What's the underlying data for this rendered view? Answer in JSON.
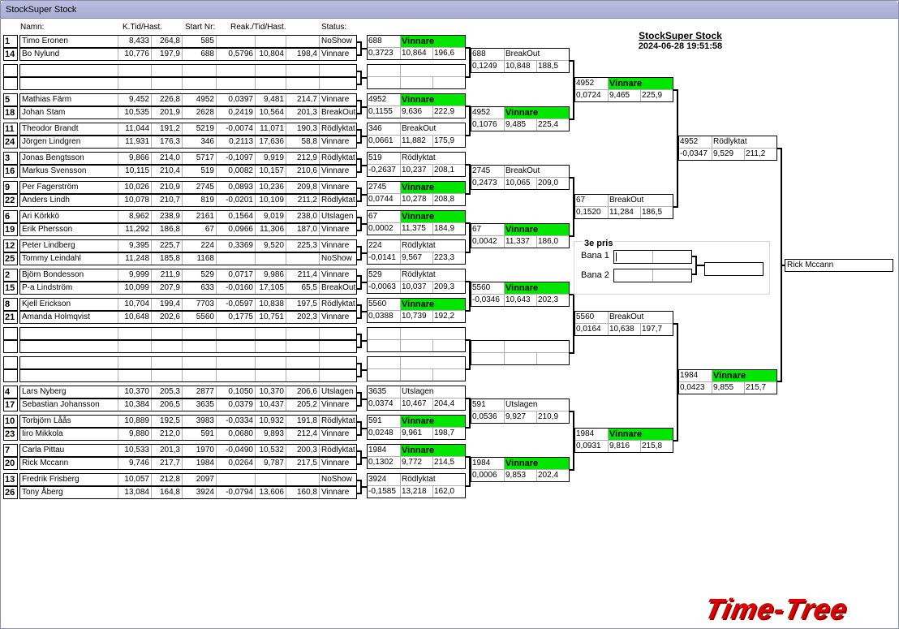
{
  "window": {
    "title": "StockSuper Stock"
  },
  "header": {
    "title": "StockSuper Stock",
    "datetime": "2024-06-28 19:51:58"
  },
  "columns": {
    "name": "Namn:",
    "ktid": "K.Tid/Hast.",
    "start": "Start Nr:",
    "reak": "Reak./Tid/Hast.",
    "status": "Status:"
  },
  "round1": [
    {
      "seed": "1",
      "name": "Timo Eronen",
      "kt": "8,433",
      "kh": "264,8",
      "start": "585",
      "r": "",
      "t": "",
      "h": "",
      "status": "NoShow"
    },
    {
      "seed": "14",
      "name": "Bo Nylund",
      "kt": "10,776",
      "kh": "197,9",
      "start": "688",
      "r": "0,5796",
      "t": "10,804",
      "h": "198,4",
      "status": "Vinnare"
    },
    {
      "seed": "",
      "name": "",
      "kt": "",
      "kh": "",
      "start": "",
      "r": "",
      "t": "",
      "h": "",
      "status": ""
    },
    {
      "seed": "",
      "name": "",
      "kt": "",
      "kh": "",
      "start": "",
      "r": "",
      "t": "",
      "h": "",
      "status": ""
    },
    {
      "seed": "5",
      "name": "Mathias Färm",
      "kt": "9,452",
      "kh": "226,8",
      "start": "4952",
      "r": "0,0397",
      "t": "9,481",
      "h": "214,7",
      "status": "Vinnare"
    },
    {
      "seed": "18",
      "name": "Johan Stam",
      "kt": "10,535",
      "kh": "201,9",
      "start": "2628",
      "r": "0,2419",
      "t": "10,564",
      "h": "201,3",
      "status": "BreakOut"
    },
    {
      "seed": "11",
      "name": "Theodor Brandt",
      "kt": "11,044",
      "kh": "191,2",
      "start": "5219",
      "r": "-0,0074",
      "t": "11,071",
      "h": "190,3",
      "status": "Rödlyktat"
    },
    {
      "seed": "24",
      "name": "Jörgen Lindgren",
      "kt": "11,931",
      "kh": "176,3",
      "start": "346",
      "r": "0,2113",
      "t": "17,636",
      "h": "58,8",
      "status": "Vinnare"
    },
    {
      "seed": "3",
      "name": "Jonas Bengtsson",
      "kt": "9,866",
      "kh": "214,0",
      "start": "5717",
      "r": "-0,1097",
      "t": "9,919",
      "h": "212,9",
      "status": "Rödlyktat"
    },
    {
      "seed": "16",
      "name": "Markus Svensson",
      "kt": "10,115",
      "kh": "210,4",
      "start": "519",
      "r": "0,0082",
      "t": "10,157",
      "h": "210,6",
      "status": "Vinnare"
    },
    {
      "seed": "9",
      "name": "Per  Fagerström",
      "kt": "10,026",
      "kh": "210,9",
      "start": "2745",
      "r": "0,0893",
      "t": "10,236",
      "h": "209,8",
      "status": "Vinnare"
    },
    {
      "seed": "22",
      "name": "Anders Lindh",
      "kt": "10,078",
      "kh": "210,7",
      "start": "819",
      "r": "-0,0201",
      "t": "10,109",
      "h": "211,2",
      "status": "Rödlyktat"
    },
    {
      "seed": "6",
      "name": "Ari Körkkö",
      "kt": "8,962",
      "kh": "238,9",
      "start": "2161",
      "r": "0,1564",
      "t": "9,019",
      "h": "238,0",
      "status": "Utslagen"
    },
    {
      "seed": "19",
      "name": "Erik Phersson",
      "kt": "11,292",
      "kh": "186,8",
      "start": "67",
      "r": "0,0966",
      "t": "11,306",
      "h": "187,0",
      "status": "Vinnare"
    },
    {
      "seed": "12",
      "name": "Peter Lindberg",
      "kt": "9,395",
      "kh": "225,7",
      "start": "224",
      "r": "0,3369",
      "t": "9,520",
      "h": "225,3",
      "status": "Vinnare"
    },
    {
      "seed": "25",
      "name": "Tommy  Leindahl",
      "kt": "11,248",
      "kh": "185,8",
      "start": "1168",
      "r": "",
      "t": "",
      "h": "",
      "status": "NoShow"
    },
    {
      "seed": "2",
      "name": "Björn Bondesson",
      "kt": "9,999",
      "kh": "211,9",
      "start": "529",
      "r": "0,0717",
      "t": "9,986",
      "h": "211,4",
      "status": "Vinnare"
    },
    {
      "seed": "15",
      "name": "P-a Lindström",
      "kt": "10,099",
      "kh": "207,9",
      "start": "633",
      "r": "-0,0160",
      "t": "17,105",
      "h": "65,5",
      "status": "BreakOut"
    },
    {
      "seed": "8",
      "name": "Kjell Erickson",
      "kt": "10,704",
      "kh": "199,4",
      "start": "7703",
      "r": "-0,0597",
      "t": "10,838",
      "h": "197,5",
      "status": "Rödlyktat"
    },
    {
      "seed": "21",
      "name": "Amanda Holmqvist",
      "kt": "10,648",
      "kh": "202,6",
      "start": "5560",
      "r": "0,1775",
      "t": "10,751",
      "h": "202,3",
      "status": "Vinnare"
    },
    {
      "seed": "",
      "name": "",
      "kt": "",
      "kh": "",
      "start": "",
      "r": "",
      "t": "",
      "h": "",
      "status": ""
    },
    {
      "seed": "",
      "name": "",
      "kt": "",
      "kh": "",
      "start": "",
      "r": "",
      "t": "",
      "h": "",
      "status": ""
    },
    {
      "seed": "",
      "name": "",
      "kt": "",
      "kh": "",
      "start": "",
      "r": "",
      "t": "",
      "h": "",
      "status": ""
    },
    {
      "seed": "",
      "name": "",
      "kt": "",
      "kh": "",
      "start": "",
      "r": "",
      "t": "",
      "h": "",
      "status": ""
    },
    {
      "seed": "4",
      "name": "Lars Nyberg",
      "kt": "10,370",
      "kh": "205,3",
      "start": "2877",
      "r": "0,1050",
      "t": "10,370",
      "h": "206,6",
      "status": "Utslagen"
    },
    {
      "seed": "17",
      "name": "Sebastian Johansson",
      "kt": "10,384",
      "kh": "206,5",
      "start": "3635",
      "r": "0,0379",
      "t": "10,437",
      "h": "205,2",
      "status": "Vinnare"
    },
    {
      "seed": "10",
      "name": "Torbjörn Låås",
      "kt": "10,889",
      "kh": "192,5",
      "start": "3983",
      "r": "-0,0334",
      "t": "10,932",
      "h": "191,8",
      "status": "Rödlyktat"
    },
    {
      "seed": "23",
      "name": "Iiro Mikkola",
      "kt": "9,880",
      "kh": "212,0",
      "start": "591",
      "r": "0,0680",
      "t": "9,893",
      "h": "212,4",
      "status": "Vinnare"
    },
    {
      "seed": "7",
      "name": "Carla Pittau",
      "kt": "10,533",
      "kh": "201,3",
      "start": "1970",
      "r": "-0,0490",
      "t": "10,532",
      "h": "200,3",
      "status": "Rödlyktat"
    },
    {
      "seed": "20",
      "name": "Rick Mccann",
      "kt": "9,746",
      "kh": "217,7",
      "start": "1984",
      "r": "0,0264",
      "t": "9,787",
      "h": "217,5",
      "status": "Vinnare"
    },
    {
      "seed": "13",
      "name": "Fredrik Frisberg",
      "kt": "10,057",
      "kh": "212,8",
      "start": "2097",
      "r": "",
      "t": "",
      "h": "",
      "status": "NoShow"
    },
    {
      "seed": "26",
      "name": "Tony Åberg",
      "kt": "13,084",
      "kh": "164,8",
      "start": "3924",
      "r": "-0,0794",
      "t": "13,606",
      "h": "160,8",
      "status": "Vinnare"
    }
  ],
  "round2": [
    {
      "id": "688",
      "status": "Vinnare",
      "win": true,
      "r": "0,3723",
      "t": "10,864",
      "h": "196,6"
    },
    {
      "id": "",
      "status": "",
      "win": false,
      "r": "",
      "t": "",
      "h": ""
    },
    {
      "id": "4952",
      "status": "Vinnare",
      "win": true,
      "r": "0,1155",
      "t": "9,636",
      "h": "222,9"
    },
    {
      "id": "346",
      "status": "BreakOut",
      "win": false,
      "r": "0,0661",
      "t": "11,882",
      "h": "175,9"
    },
    {
      "id": "519",
      "status": "Rödlyktat",
      "win": false,
      "r": "-0,2637",
      "t": "10,237",
      "h": "208,1"
    },
    {
      "id": "2745",
      "status": "Vinnare",
      "win": true,
      "r": "0,0744",
      "t": "10,278",
      "h": "208,8"
    },
    {
      "id": "67",
      "status": "Vinnare",
      "win": true,
      "r": "0,0002",
      "t": "11,375",
      "h": "184,9"
    },
    {
      "id": "224",
      "status": "Rödlyktat",
      "win": false,
      "r": "-0,0141",
      "t": "9,567",
      "h": "223,3"
    },
    {
      "id": "529",
      "status": "Rödlyktat",
      "win": false,
      "r": "-0,0063",
      "t": "10,037",
      "h": "209,3"
    },
    {
      "id": "5560",
      "status": "Vinnare",
      "win": true,
      "r": "0,0388",
      "t": "10,739",
      "h": "192,2"
    },
    {
      "id": "",
      "status": "",
      "win": false,
      "r": "",
      "t": "",
      "h": ""
    },
    {
      "id": "",
      "status": "",
      "win": false,
      "r": "",
      "t": "",
      "h": ""
    },
    {
      "id": "3635",
      "status": "Utslagen",
      "win": false,
      "r": "0,0374",
      "t": "10,467",
      "h": "204,4"
    },
    {
      "id": "591",
      "status": "Vinnare",
      "win": true,
      "r": "0,0248",
      "t": "9,961",
      "h": "198,7"
    },
    {
      "id": "1984",
      "status": "Vinnare",
      "win": true,
      "r": "0,1302",
      "t": "9,772",
      "h": "214,5"
    },
    {
      "id": "3924",
      "status": "Rödlyktat",
      "win": false,
      "r": "-0,1585",
      "t": "13,218",
      "h": "162,0"
    }
  ],
  "round3": [
    {
      "id": "688",
      "status": "BreakOut",
      "win": false,
      "r": "0,1249",
      "t": "10,848",
      "h": "188,5"
    },
    {
      "id": "4952",
      "status": "Vinnare",
      "win": true,
      "r": "0,1076",
      "t": "9,485",
      "h": "225,4"
    },
    {
      "id": "2745",
      "status": "BreakOut",
      "win": false,
      "r": "0,2473",
      "t": "10,065",
      "h": "209,0"
    },
    {
      "id": "67",
      "status": "Vinnare",
      "win": true,
      "r": "0,0042",
      "t": "11,337",
      "h": "186,0"
    },
    {
      "id": "5560",
      "status": "Vinnare",
      "win": true,
      "r": "-0,0346",
      "t": "10,643",
      "h": "202,3"
    },
    {
      "id": "",
      "status": "",
      "win": false,
      "r": "",
      "t": "",
      "h": ""
    },
    {
      "id": "591",
      "status": "Utslagen",
      "win": false,
      "r": "0,0536",
      "t": "9,927",
      "h": "210,9"
    },
    {
      "id": "1984",
      "status": "Vinnare",
      "win": true,
      "r": "0,0006",
      "t": "9,853",
      "h": "202,4"
    }
  ],
  "round4": [
    {
      "id": "4952",
      "status": "Vinnare",
      "win": true,
      "r": "0,0724",
      "t": "9,465",
      "h": "225,9"
    },
    {
      "id": "67",
      "status": "BreakOut",
      "win": false,
      "r": "0,1520",
      "t": "11,284",
      "h": "186,5"
    },
    {
      "id": "5560",
      "status": "BreakOut",
      "win": false,
      "r": "0,0164",
      "t": "10,638",
      "h": "197,7"
    },
    {
      "id": "1984",
      "status": "Vinnare",
      "win": true,
      "r": "0,0931",
      "t": "9,816",
      "h": "215,8"
    }
  ],
  "round5": [
    {
      "id": "4952",
      "status": "Rödlyktat",
      "win": false,
      "r": "-0,0347",
      "t": "9,529",
      "h": "211,2"
    },
    {
      "id": "1984",
      "status": "Vinnare",
      "win": true,
      "r": "0,0423",
      "t": "9,855",
      "h": "215,7"
    }
  ],
  "third_place": {
    "title": "3e pris",
    "lane1": "Bana 1",
    "lane2": "Bana 2"
  },
  "champion": "Rick Mccann",
  "logo": "Time-Tree",
  "colors": {
    "winner": "#00e600",
    "titlebar": "#b1b5dc",
    "logo": "#e00000"
  }
}
